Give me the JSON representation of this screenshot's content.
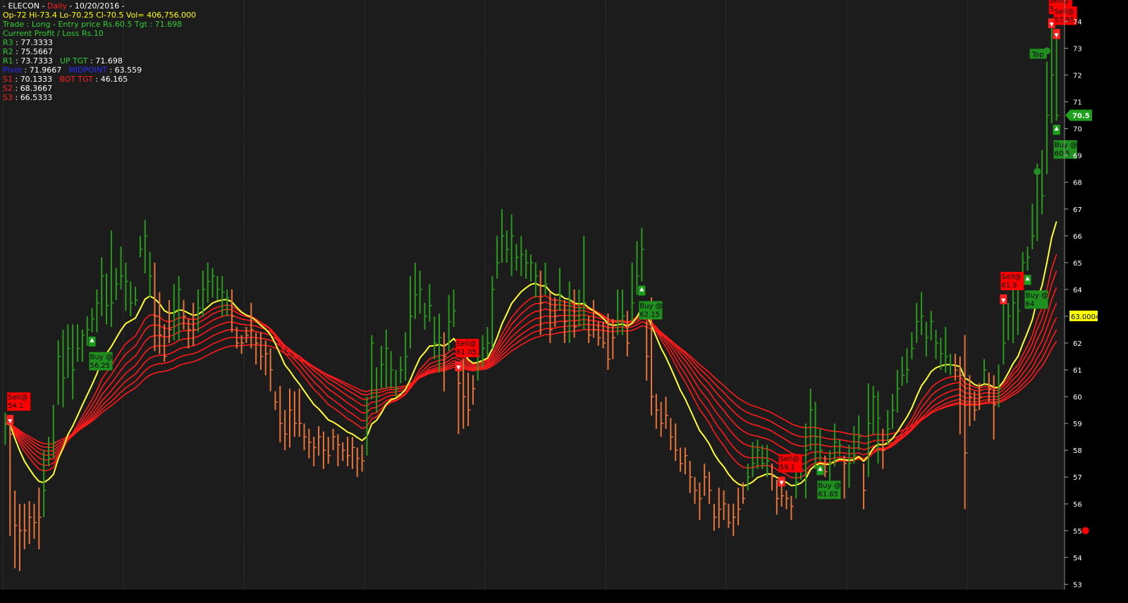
{
  "header": {
    "line1": {
      "prefix": " - ",
      "symbol": "ELECON",
      "sep1": " - ",
      "interval": "Daily",
      "sep2": " - ",
      "date": "10/20/2016",
      "suffix": " - "
    },
    "line2": "Op-72  Hi-73.4  Lo-70.25  Cl-70.5  Vol= 406,756.000",
    "line3": "Trade : Long - Entry price Rs.60.5 Tgt : 71.698",
    "line4": "Current Profit / Loss Rs.10"
  },
  "pivots": {
    "r3": {
      "label": "R3",
      "value": "77.3333"
    },
    "r2": {
      "label": "R2",
      "value": "75.5667"
    },
    "r1": {
      "label": "R1",
      "value": "73.7333"
    },
    "up_tgt": {
      "label": "UP TGT",
      "value": "71.698"
    },
    "pivot": {
      "label": "Pivot",
      "value": "71.9667"
    },
    "midpoint": {
      "label": "MIDPOINT",
      "value": "63.559"
    },
    "s1": {
      "label": "S1",
      "value": "70.1333"
    },
    "bot_tgt": {
      "label": "BOT TGT",
      "value": "46.165"
    },
    "s2": {
      "label": "S2",
      "value": "68.3667"
    },
    "s3": {
      "label": "S3",
      "value": "66.5333"
    }
  },
  "colors": {
    "background": "#000000",
    "plot_bg": "#1c1c1c",
    "grid": "#3a3a3a",
    "up_bar": "#2a9a1f",
    "down_bar": "#e8743b",
    "ema_yellow": "#ffff33",
    "ema_red": "#ff1a1a",
    "sell_box": "#ff0000",
    "buy_box": "#1f8f1f",
    "text_yellow": "#ffff00",
    "text_green": "#33cc33",
    "text_red": "#ff2020",
    "text_blue": "#2a2aff",
    "text_white": "#ffffff"
  },
  "chart_data": {
    "type": "ohlc",
    "ylim": [
      52.8,
      74.8
    ],
    "yticks": [
      53,
      54,
      55,
      56,
      57,
      58,
      59,
      60,
      61,
      62,
      63,
      64,
      65,
      66,
      67,
      68,
      69,
      70,
      71,
      72,
      73,
      74
    ],
    "grid": true,
    "last_close": {
      "label": "70.5",
      "value": 70.5
    },
    "ema_value": {
      "label": "63.0004",
      "value": 63.0
    },
    "bars": [
      [
        59.0,
        58.2,
        59.4
      ],
      [
        58.6,
        54.8,
        59.0
      ],
      [
        55.2,
        53.6,
        56.5
      ],
      [
        55.0,
        53.5,
        56.0
      ],
      [
        55.0,
        54.3,
        56.0
      ],
      [
        55.5,
        54.5,
        56.1
      ],
      [
        55.3,
        54.7,
        56.0
      ],
      [
        55.5,
        54.3,
        56.6
      ],
      [
        56.5,
        55.5,
        58.0
      ],
      [
        57.7,
        57.4,
        58.5
      ],
      [
        58.3,
        57.7,
        59.7
      ],
      [
        61.5,
        59.7,
        62.1
      ],
      [
        60.7,
        59.6,
        62.5
      ],
      [
        61.8,
        60.7,
        62.7
      ],
      [
        61.0,
        59.9,
        62.7
      ],
      [
        61.8,
        61.3,
        62.7
      ],
      [
        62.3,
        61.3,
        62.5
      ],
      [
        62.5,
        61.9,
        63.0
      ],
      [
        62.9,
        62.4,
        63.3
      ],
      [
        63.5,
        62.4,
        64.0
      ],
      [
        64.5,
        63.0,
        65.2
      ],
      [
        63.4,
        62.7,
        64.6
      ],
      [
        63.5,
        62.6,
        66.2
      ],
      [
        64.2,
        63.6,
        64.8
      ],
      [
        64.5,
        64.0,
        65.6
      ],
      [
        64.3,
        63.2,
        65.0
      ],
      [
        63.5,
        63.0,
        64.3
      ],
      [
        63.6,
        63.4,
        64.1
      ],
      [
        65.5,
        65.2,
        66.0
      ],
      [
        66.0,
        64.6,
        66.6
      ],
      [
        64.5,
        63.7,
        65.4
      ],
      [
        63.0,
        61.7,
        65.0
      ],
      [
        62.3,
        61.6,
        63.9
      ],
      [
        61.5,
        61.3,
        62.7
      ],
      [
        62.5,
        62.0,
        63.6
      ],
      [
        63.2,
        62.1,
        64.2
      ],
      [
        64.0,
        62.1,
        64.5
      ],
      [
        63.0,
        62.5,
        63.6
      ],
      [
        62.5,
        61.8,
        62.9
      ],
      [
        62.5,
        61.9,
        63.5
      ],
      [
        63.3,
        62.4,
        64.0
      ],
      [
        64.0,
        63.0,
        64.7
      ],
      [
        64.3,
        63.5,
        65.0
      ],
      [
        64.5,
        63.7,
        64.8
      ],
      [
        64.0,
        63.6,
        64.5
      ],
      [
        63.9,
        63.0,
        64.5
      ],
      [
        63.7,
        63.0,
        64.0
      ],
      [
        63.0,
        62.4,
        64.0
      ],
      [
        62.0,
        61.8,
        62.6
      ],
      [
        62.0,
        61.6,
        62.3
      ],
      [
        62.3,
        62.0,
        62.6
      ],
      [
        62.5,
        61.8,
        63.5
      ],
      [
        62.0,
        61.2,
        62.4
      ],
      [
        61.5,
        61.0,
        62.4
      ],
      [
        61.6,
        60.8,
        62.1
      ],
      [
        61.0,
        60.2,
        61.8
      ],
      [
        59.8,
        59.5,
        60.2
      ],
      [
        59.0,
        58.3,
        60.4
      ],
      [
        58.6,
        58.0,
        59.5
      ],
      [
        59.5,
        58.1,
        60.3
      ],
      [
        59.0,
        58.5,
        60.2
      ],
      [
        59.0,
        58.5,
        60.3
      ],
      [
        58.5,
        58.0,
        59.0
      ],
      [
        58.3,
        57.7,
        58.8
      ],
      [
        58.1,
        57.4,
        58.5
      ],
      [
        58.5,
        57.8,
        58.9
      ],
      [
        58.0,
        57.3,
        58.7
      ],
      [
        57.8,
        57.5,
        58.5
      ],
      [
        58.5,
        58.0,
        58.8
      ],
      [
        58.2,
        57.4,
        58.6
      ],
      [
        58.0,
        57.6,
        58.3
      ],
      [
        57.8,
        57.4,
        58.5
      ],
      [
        58.1,
        57.3,
        58.5
      ],
      [
        57.7,
        57.0,
        58.1
      ],
      [
        57.6,
        57.2,
        58.2
      ],
      [
        59.5,
        57.8,
        60.0
      ],
      [
        62.0,
        59.9,
        62.3
      ],
      [
        60.0,
        59.4,
        61.1
      ],
      [
        61.2,
        60.3,
        61.9
      ],
      [
        61.8,
        60.3,
        62.5
      ],
      [
        61.0,
        60.3,
        61.7
      ],
      [
        60.3,
        60.0,
        61.0
      ],
      [
        61.0,
        60.5,
        61.5
      ],
      [
        61.5,
        60.6,
        62.4
      ],
      [
        63.0,
        61.8,
        64.5
      ],
      [
        63.8,
        62.9,
        65.0
      ],
      [
        64.0,
        63.1,
        64.7
      ],
      [
        63.0,
        62.5,
        63.5
      ],
      [
        63.4,
        62.8,
        64.2
      ],
      [
        62.0,
        61.4,
        63.0
      ],
      [
        62.2,
        60.9,
        63.1
      ],
      [
        61.5,
        60.2,
        62.4
      ],
      [
        62.8,
        61.7,
        63.8
      ],
      [
        63.2,
        62.6,
        64.0
      ],
      [
        60.5,
        58.6,
        61.0
      ],
      [
        60.0,
        58.8,
        61.4
      ],
      [
        59.5,
        58.9,
        60.9
      ],
      [
        60.3,
        59.7,
        60.8
      ],
      [
        61.5,
        60.6,
        62.0
      ],
      [
        61.8,
        61.1,
        62.3
      ],
      [
        62.0,
        61.5,
        62.6
      ],
      [
        64.0,
        61.8,
        64.5
      ],
      [
        65.0,
        64.4,
        66.0
      ],
      [
        66.0,
        65.0,
        67.0
      ],
      [
        65.5,
        65.0,
        66.2
      ],
      [
        66.0,
        64.5,
        66.8
      ],
      [
        65.2,
        64.7,
        65.7
      ],
      [
        65.3,
        64.5,
        66.0
      ],
      [
        65.0,
        64.4,
        65.5
      ],
      [
        65.0,
        64.3,
        65.3
      ],
      [
        64.5,
        63.7,
        65.0
      ],
      [
        63.5,
        62.3,
        64.7
      ],
      [
        64.2,
        63.8,
        65.0
      ],
      [
        62.5,
        62.0,
        63.9
      ],
      [
        63.0,
        62.6,
        63.7
      ],
      [
        63.8,
        63.2,
        64.8
      ],
      [
        62.8,
        62.0,
        63.6
      ],
      [
        63.4,
        62.0,
        64.3
      ],
      [
        62.6,
        62.2,
        64.0
      ],
      [
        63.3,
        62.6,
        64.0
      ],
      [
        63.5,
        62.5,
        66.0
      ],
      [
        62.3,
        62.0,
        63.0
      ],
      [
        62.5,
        62.2,
        63.6
      ],
      [
        62.2,
        61.9,
        62.8
      ],
      [
        62.0,
        61.8,
        62.8
      ],
      [
        61.4,
        61.0,
        63.1
      ],
      [
        62.2,
        61.4,
        62.9
      ],
      [
        62.8,
        62.3,
        64.0
      ],
      [
        63.0,
        62.3,
        64.0
      ],
      [
        62.0,
        61.5,
        63.2
      ],
      [
        63.5,
        62.8,
        65.0
      ],
      [
        64.5,
        63.8,
        65.8
      ],
      [
        65.5,
        64.3,
        66.3
      ],
      [
        61.5,
        60.6,
        62.8
      ],
      [
        60.0,
        59.3,
        63.7
      ],
      [
        59.5,
        58.8,
        60.1
      ],
      [
        59.0,
        58.5,
        59.8
      ],
      [
        59.3,
        58.8,
        60.0
      ],
      [
        58.5,
        58.0,
        59.2
      ],
      [
        58.0,
        57.6,
        59.0
      ],
      [
        57.5,
        57.2,
        58.1
      ],
      [
        57.8,
        57.1,
        58.1
      ],
      [
        57.0,
        56.4,
        57.6
      ],
      [
        56.5,
        56.0,
        57.0
      ],
      [
        56.2,
        55.4,
        56.8
      ],
      [
        57.0,
        56.3,
        57.5
      ],
      [
        56.5,
        56.0,
        57.2
      ],
      [
        55.5,
        55.0,
        56.0
      ],
      [
        55.8,
        55.1,
        56.6
      ],
      [
        56.0,
        55.4,
        56.5
      ],
      [
        55.3,
        55.1,
        56.0
      ],
      [
        55.5,
        54.8,
        56.0
      ],
      [
        55.8,
        55.2,
        56.6
      ],
      [
        56.2,
        56.0,
        56.8
      ],
      [
        57.0,
        56.5,
        57.5
      ],
      [
        57.5,
        57.0,
        58.3
      ],
      [
        58.0,
        57.3,
        58.4
      ],
      [
        57.5,
        57.3,
        58.2
      ],
      [
        57.6,
        57.0,
        58.2
      ],
      [
        57.0,
        56.5,
        57.5
      ],
      [
        56.2,
        55.6,
        56.9
      ],
      [
        56.3,
        55.9,
        56.7
      ],
      [
        56.2,
        55.8,
        56.5
      ],
      [
        55.9,
        55.4,
        56.3
      ],
      [
        56.8,
        56.2,
        57.3
      ],
      [
        57.3,
        56.9,
        57.5
      ],
      [
        58.0,
        56.2,
        59.0
      ],
      [
        59.5,
        58.0,
        60.3
      ],
      [
        58.5,
        57.3,
        59.8
      ],
      [
        58.0,
        57.6,
        58.8
      ],
      [
        57.2,
        57.0,
        57.8
      ],
      [
        57.5,
        56.7,
        58.0
      ],
      [
        58.3,
        57.4,
        59.0
      ],
      [
        58.2,
        57.8,
        58.4
      ],
      [
        57.5,
        56.2,
        57.8
      ],
      [
        57.5,
        56.6,
        58.2
      ],
      [
        57.8,
        57.5,
        58.9
      ],
      [
        58.5,
        58.0,
        59.3
      ],
      [
        56.5,
        55.8,
        57.5
      ],
      [
        59.0,
        57.0,
        60.5
      ],
      [
        60.0,
        58.6,
        60.4
      ],
      [
        59.2,
        57.5,
        60.2
      ],
      [
        58.0,
        57.3,
        58.8
      ],
      [
        58.8,
        58.2,
        59.5
      ],
      [
        59.5,
        58.8,
        60.1
      ],
      [
        60.3,
        59.4,
        61.0
      ],
      [
        60.8,
        60.4,
        61.5
      ],
      [
        61.0,
        60.5,
        61.8
      ],
      [
        61.8,
        61.4,
        62.4
      ],
      [
        62.8,
        62.0,
        63.5
      ],
      [
        63.0,
        62.3,
        63.9
      ],
      [
        62.2,
        61.5,
        62.8
      ],
      [
        62.8,
        62.1,
        63.2
      ],
      [
        62.0,
        61.4,
        62.5
      ],
      [
        61.6,
        61.0,
        62.2
      ],
      [
        61.5,
        60.9,
        62.6
      ],
      [
        61.2,
        60.8,
        61.6
      ],
      [
        61.0,
        60.6,
        61.6
      ],
      [
        60.8,
        58.6,
        61.5
      ],
      [
        57.9,
        55.8,
        62.3
      ],
      [
        60.0,
        58.9,
        60.8
      ],
      [
        59.5,
        59.1,
        60.2
      ],
      [
        60.0,
        59.5,
        60.5
      ],
      [
        61.0,
        60.5,
        61.4
      ],
      [
        60.3,
        59.8,
        60.9
      ],
      [
        59.7,
        58.4,
        60.8
      ],
      [
        60.3,
        59.6,
        61.2
      ],
      [
        62.0,
        61.2,
        63.5
      ],
      [
        63.0,
        62.1,
        63.5
      ],
      [
        63.5,
        62.0,
        64.0
      ],
      [
        63.2,
        62.3,
        64.5
      ],
      [
        65.0,
        64.0,
        65.4
      ],
      [
        65.2,
        64.7,
        65.6
      ],
      [
        66.0,
        65.5,
        67.2
      ],
      [
        68.5,
        65.8,
        68.7
      ],
      [
        67.5,
        66.8,
        69.2
      ],
      [
        70.5,
        68.3,
        72.5
      ],
      [
        72.0,
        70.2,
        73.8
      ],
      [
        70.5,
        70.3,
        73.4
      ]
    ],
    "signals": [
      {
        "type": "sell",
        "text1": "Sell@",
        "text2": "54.1",
        "bar": 1
      },
      {
        "type": "buy",
        "text1": "Buy @",
        "text2": "56.25",
        "bar": 18
      },
      {
        "type": "sell",
        "text1": "Sell@",
        "text2": "61.05",
        "bar": 94
      },
      {
        "type": "buy",
        "text1": "Buy @",
        "text2": "62.15",
        "bar": 132
      },
      {
        "type": "sell",
        "text1": "Sell@",
        "text2": "59.1",
        "bar": 161
      },
      {
        "type": "buy",
        "text1": "Buy @",
        "text2": "61.65",
        "bar": 169
      },
      {
        "type": "sell",
        "text1": "Sell@",
        "text2": "61.9",
        "bar": 207
      },
      {
        "type": "sell",
        "text1": "Sell@",
        "text2": "59.8",
        "bar": 217
      },
      {
        "type": "buy",
        "text1": "Buy @",
        "text2": "64",
        "bar": 212
      },
      {
        "type": "sell",
        "text1": "Sell@",
        "text2": "57.1",
        "bar": 297
      },
      {
        "type": "buy",
        "text1": "Buy @",
        "text2": "59.35",
        "bar": 297
      },
      {
        "type": "buy",
        "text1": "Buy @",
        "text2": "59.1",
        "bar": 305
      },
      {
        "type": "sell",
        "text1": "Sell@",
        "text2": "57.95",
        "bar": 333
      },
      {
        "type": "buy",
        "text1": "Buy @",
        "text2": "60.5",
        "bar": 340
      }
    ],
    "top_label": "Top"
  }
}
